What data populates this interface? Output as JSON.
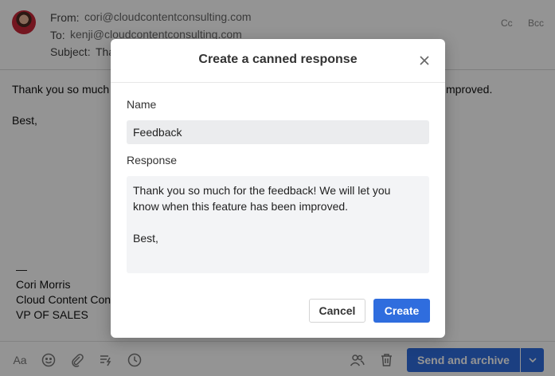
{
  "composer": {
    "from_label": "From:",
    "from_value": "cori@cloudcontentconsulting.com",
    "to_label": "To:",
    "to_value": "kenji@cloudcontentconsulting.com",
    "subject_label": "Subject:",
    "subject_value": "Tha",
    "cc": "Cc",
    "bcc": "Bcc",
    "body_line_1_start": "Thank you so much",
    "body_line_1_end": "mproved.",
    "body_line_2": "Best,",
    "signature": {
      "dash": "—",
      "name": "Cori Morris",
      "company": "Cloud Content Con",
      "title": "VP OF SALES"
    },
    "toolbar": {
      "format_icon_text": "Aa",
      "send_label": "Send and archive"
    }
  },
  "modal": {
    "title": "Create a canned response",
    "name_label": "Name",
    "name_value": "Feedback",
    "response_label": "Response",
    "response_lines": [
      "Thank you so much for the feedback! We will let you",
      "know when this feature has been improved.",
      "",
      "Best,"
    ],
    "cancel_label": "Cancel",
    "create_label": "Create"
  },
  "colors": {
    "accent": "#2f6dde",
    "overlay": "rgba(0,0,0,0.42)"
  }
}
